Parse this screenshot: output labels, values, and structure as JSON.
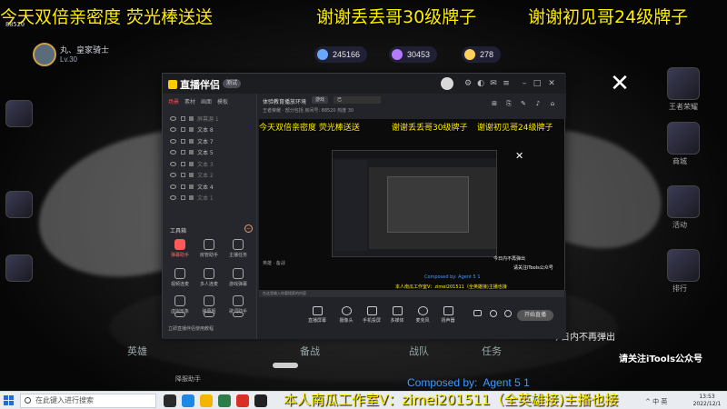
{
  "overlay": {
    "marquee_1": "今天双倍亲密度 荧光棒送送",
    "marquee_2": "谢谢丢丢哥30级牌子",
    "marquee_3": "谢谢初见哥24级牌子",
    "corner_number": "88520",
    "never_popup": "今日内不再弹出",
    "follow_tip": "请关注iTools公众号",
    "composed_by": "Composed by:",
    "agent": "Agent 5 1",
    "studio_line": "本人南瓜工作室V：zimei201511（全英雄接)主播也接"
  },
  "game_bg": {
    "player_name": "丸、皇家骑士",
    "player_level": "Lv.30",
    "stat_1": "245166",
    "stat_2": "30453",
    "stat_3": "278",
    "bottom_tabs": [
      "英雄",
      "备战",
      "战队",
      "任务"
    ],
    "bottom_sign": "降服助手",
    "side_labels": [
      "王者荣耀",
      "商城",
      "活动",
      "排行"
    ]
  },
  "app": {
    "name": "直播伴侣",
    "version": "测试",
    "sidebar_tabs": [
      "场景",
      "素材",
      "画面",
      "模板"
    ],
    "layers": [
      {
        "label": "屏幕源 1",
        "dim": true
      },
      {
        "label": "文本 8",
        "dim": false
      },
      {
        "label": "文本 7",
        "dim": false
      },
      {
        "label": "文本 5",
        "dim": false
      },
      {
        "label": "文本 3",
        "dim": true
      },
      {
        "label": "文本 2",
        "dim": true
      },
      {
        "label": "文本 4",
        "dim": false
      },
      {
        "label": "文本 1",
        "dim": true
      }
    ],
    "tools_header": "工具箱",
    "tools_toggle": "−",
    "tools": [
      "弹幕助手",
      "房管助手",
      "主播任务",
      "视频连麦",
      "多人连麦",
      "游戏弹幕",
      "虚拟形象",
      "弹幕姬",
      "歌词助手",
      "PK",
      "录制",
      "更多"
    ],
    "notice": "立即直播伴侣使用教程",
    "stream_title": "体验教育播放环境",
    "chip_a": "游戏",
    "chip_b": "已",
    "room_info": "王者荣耀 · 部分包括   房间号: 88520   热度 30",
    "controls": [
      "直播屏幕",
      "摄像头",
      "手机投屏",
      "多媒体",
      "麦克风",
      "扬声器"
    ],
    "start_live": "开始直播",
    "mini_taskbar": "在这里输入你要搜索的内容"
  },
  "taskbar": {
    "search_placeholder": "在此键入进行搜索",
    "tray": "^ 中 英",
    "time": "13:53",
    "date": "2022/12/1"
  },
  "colors": {
    "marquee": "#ffee00",
    "composed": "#3e9bff",
    "accent_red": "#ff5a5a"
  }
}
